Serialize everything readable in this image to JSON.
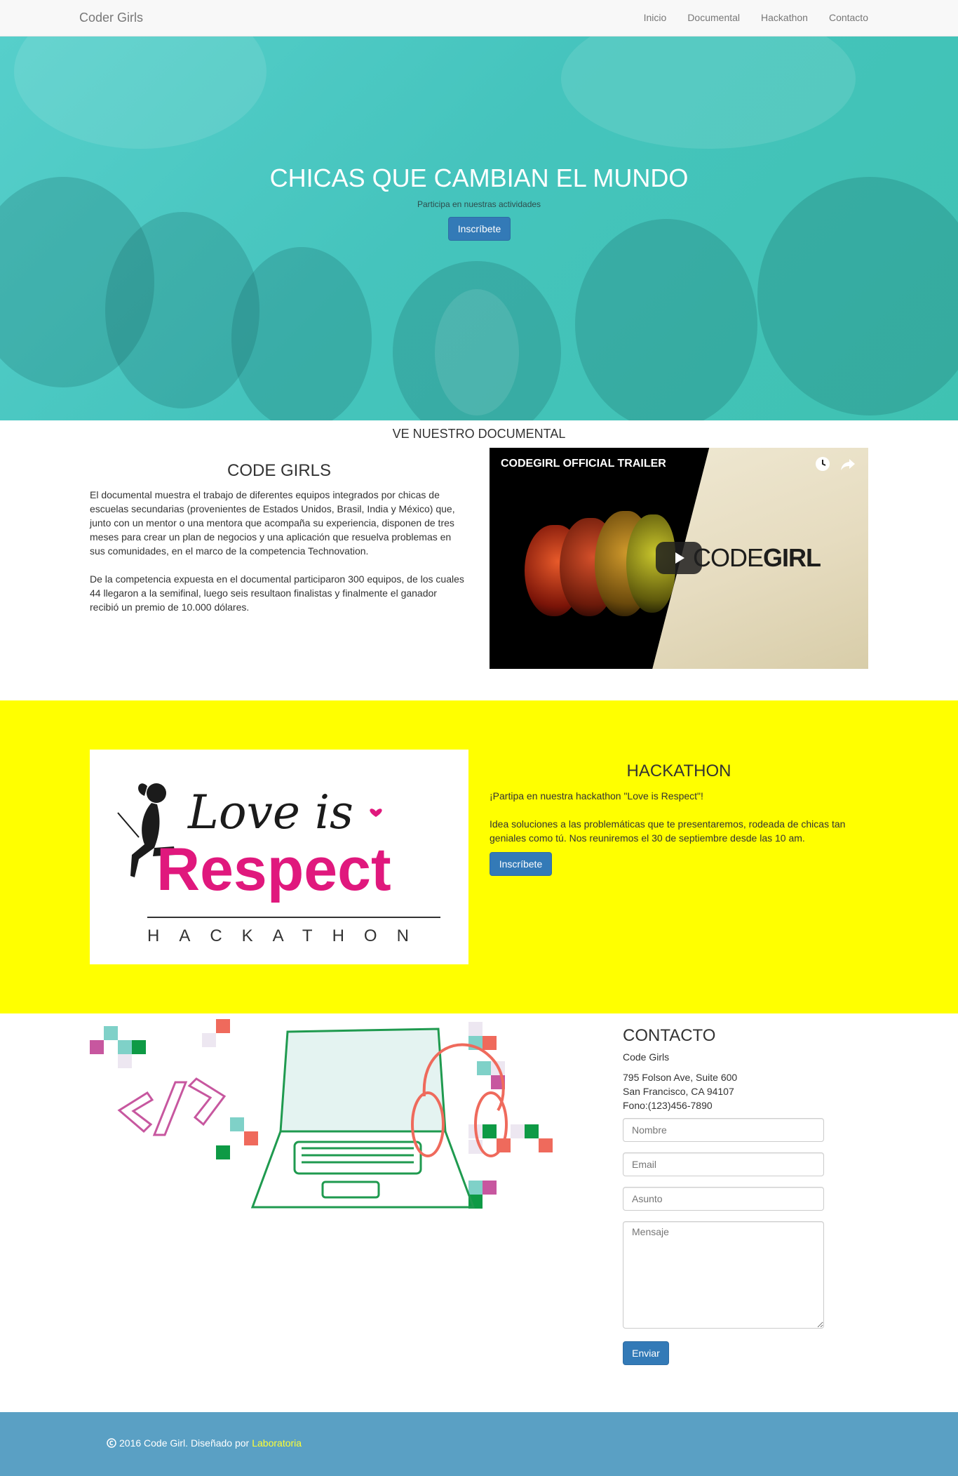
{
  "navbar": {
    "brand": "Coder Girls",
    "links": [
      "Inicio",
      "Documental",
      "Hackathon",
      "Contacto"
    ]
  },
  "hero": {
    "title": "CHICAS QUE CAMBIAN EL MUNDO",
    "subtitle": "Participa en nuestras actividades",
    "button": "Inscríbete"
  },
  "documental": {
    "heading": "VE NUESTRO DOCUMENTAL",
    "title": "CODE GIRLS",
    "paragraphs": [
      "El documental muestra el trabajo de diferentes equipos integrados por chicas de escuelas secundarias (provenientes de Estados Unidos, Brasil, India y México) que, junto con un mentor o una mentora que acompaña su experiencia, disponen de tres meses para crear un plan de negocios y una aplicación que resuelva problemas en sus comunidades, en el marco de la competencia Technovation.",
      "De la competencia expuesta en el documental participaron 300 equipos, de los cuales 44 llegaron a la semifinal, luego seis resultaon finalistas y finalmente el ganador recibió un premio de 10.000 dólares."
    ],
    "video": {
      "title": "CODEGIRL OFFICIAL TRAILER",
      "logo_light": "CODE",
      "logo_bold": "GIRL"
    }
  },
  "hackathon": {
    "title": "HACKATHON",
    "paragraphs": [
      "¡Partipa en nuestra hackathon \"Love is Respect\"!",
      "Idea soluciones a las problemáticas que te presentaremos, rodeada de chicas tan geniales como tú. Nos reuniremos el 30 de septiembre desde las 10 am."
    ],
    "button": "Inscríbete",
    "image": {
      "line1": "Love is",
      "line2": "Respect",
      "line3": "HACKATHON"
    }
  },
  "contact": {
    "title": "CONTACTO",
    "name": "Code Girls",
    "address_lines": [
      "795 Folson Ave, Suite 600",
      "San Francisco, CA 94107",
      "Fono:(123)456-7890"
    ],
    "placeholders": {
      "nombre": "Nombre",
      "email": "Email",
      "asunto": "Asunto",
      "mensaje": "Mensaje"
    },
    "button": "Enviar"
  },
  "footer": {
    "text": "2016 Code Girl. Diseñado por",
    "link": "Laboratoria",
    "copyright_icon": "copyright-icon"
  },
  "colors": {
    "hero_teal": "#45c4bd",
    "hack_yellow": "#ffff00",
    "primary_button": "#337ab7",
    "footer_blue": "#5aa0c4",
    "love_pink": "#e0187d"
  }
}
